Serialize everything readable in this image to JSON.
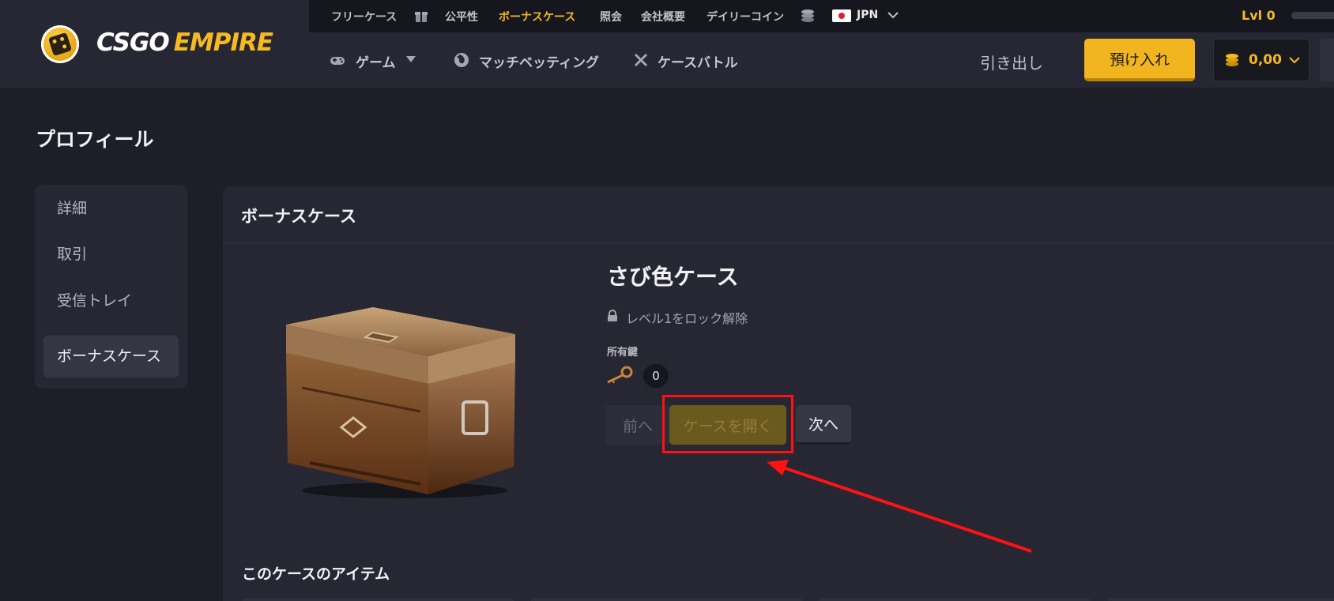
{
  "brand": {
    "part1": "CSGO",
    "part2": "EMPIRE"
  },
  "topbar": {
    "links": [
      "フリーケース",
      "公平性",
      "ボーナスケース",
      "照会",
      "会社概要",
      "デイリーコイン"
    ],
    "language": "JPN",
    "level": "Lvl 0"
  },
  "nav": {
    "games": "ゲーム",
    "match_betting": "マッチベッティング",
    "case_battle": "ケースバトル",
    "withdraw": "引き出し",
    "deposit": "預け入れ",
    "balance": "0,00"
  },
  "page": {
    "title": "プロフィール"
  },
  "sidebar": {
    "items": [
      {
        "label": "詳細"
      },
      {
        "label": "取引"
      },
      {
        "label": "受信トレイ"
      },
      {
        "label": "ボーナスケース"
      }
    ]
  },
  "panel": {
    "title": "ボーナスケース",
    "case_name": "さび色ケース",
    "unlock_text": "レベル1をロック解除",
    "keys_label": "所有鍵",
    "keys_count": "0",
    "buttons": {
      "prev": "前へ",
      "open": "ケースを開く",
      "next": "次へ"
    },
    "items_title": "このケースのアイテム"
  },
  "colors": {
    "accent": "#f5b921",
    "background": "#1d1e27",
    "panel": "#262733",
    "annotation": "#ff1212"
  }
}
